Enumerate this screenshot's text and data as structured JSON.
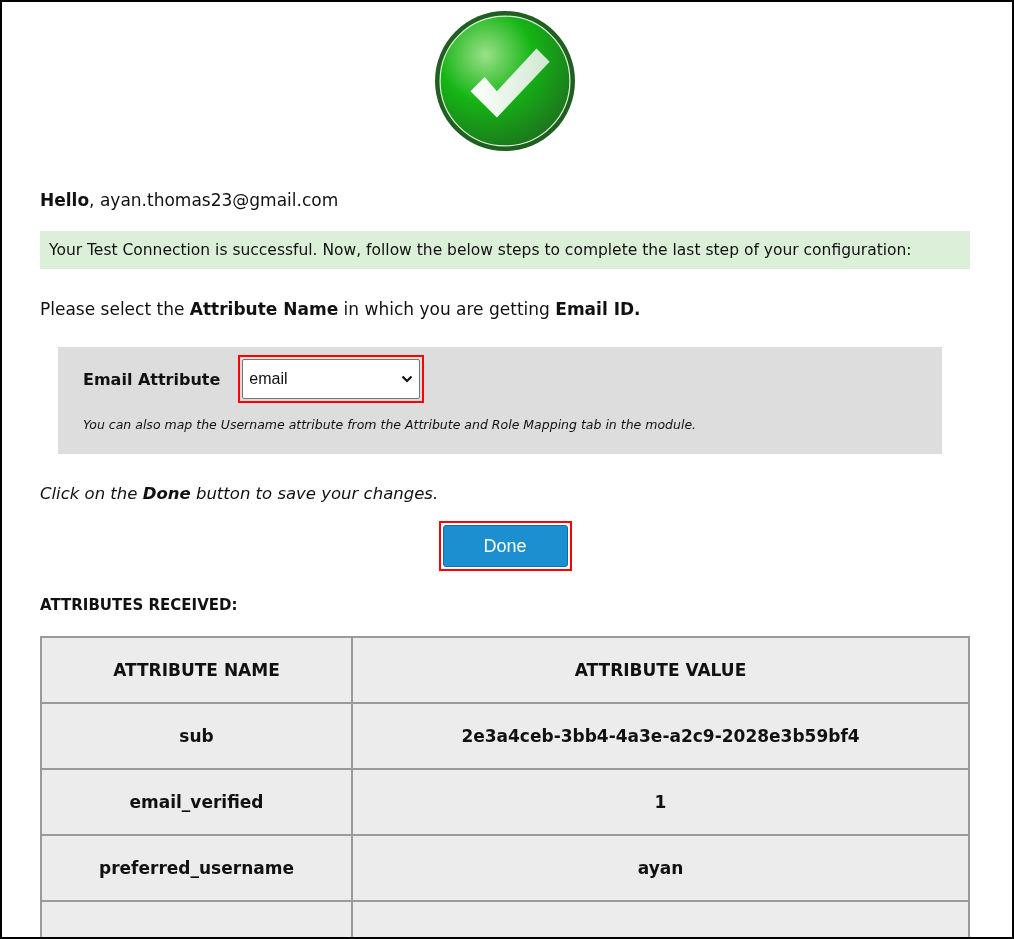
{
  "greeting": "**Hello**, ayan.thomas23@gmail.com",
  "success_message": "Your Test Connection is successful. Now, follow the below steps to complete the last step of your configuration:",
  "instruction": "Please select the **Attribute Name** in which you are getting **Email ID.**",
  "email_attribute": {
    "label": "Email Attribute",
    "value": "email",
    "highlighted": true,
    "hint": "You can also map the Username attribute from the Attribute and Role Mapping tab in the module."
  },
  "save_hint": "Click on the **Done** button to save your changes.",
  "done_button": {
    "label": "Done",
    "highlighted": true
  },
  "attributes_heading": "ATTRIBUTES RECEIVED:",
  "table": {
    "columns": [
      "ATTRIBUTE NAME",
      "ATTRIBUTE VALUE"
    ],
    "rows": [
      [
        "sub",
        "2e3a4ceb-3bb4-4a3e-a2c9-2028e3b59bf4"
      ],
      [
        "email_verified",
        "1"
      ],
      [
        "preferred_username",
        "ayan"
      ]
    ]
  }
}
